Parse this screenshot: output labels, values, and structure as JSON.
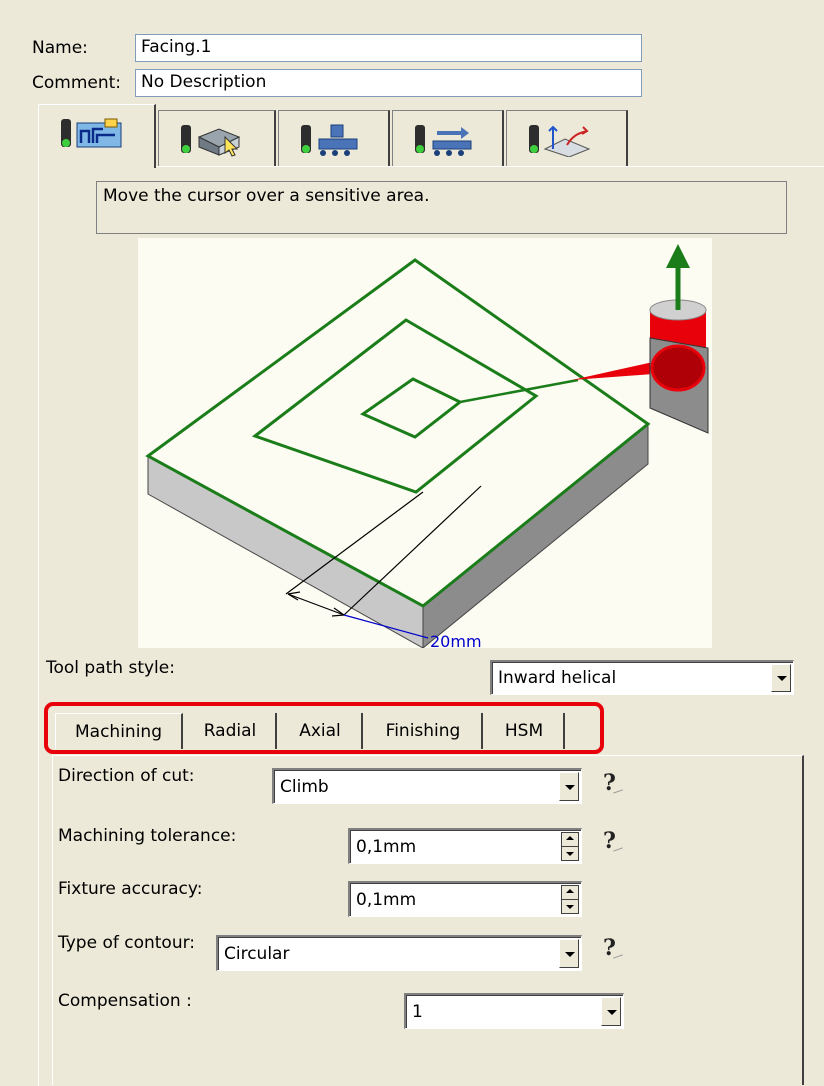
{
  "form": {
    "name_label": "Name:",
    "name_value": "Facing.1",
    "comment_label": "Comment:",
    "comment_value": "No Description"
  },
  "top_tabs": [
    {
      "icon": "strategy-parameters-icon",
      "active": true
    },
    {
      "icon": "geometry-icon",
      "active": false
    },
    {
      "icon": "tool-icon",
      "active": false
    },
    {
      "icon": "feeds-speeds-icon",
      "active": false
    },
    {
      "icon": "macro-icon",
      "active": false
    }
  ],
  "hint_text": "Move the cursor over a sensitive area.",
  "diagram": {
    "dimension_label": "20mm"
  },
  "tool_path_style": {
    "label": "Tool path style:",
    "value": "Inward helical"
  },
  "sub_tabs": [
    "Machining",
    "Radial",
    "Axial",
    "Finishing",
    "HSM"
  ],
  "machining": {
    "direction_of_cut": {
      "label": "Direction of cut:",
      "value": "Climb"
    },
    "machining_tolerance": {
      "label": "Machining tolerance:",
      "value": "0,1mm"
    },
    "fixture_accuracy": {
      "label": "Fixture accuracy:",
      "value": "0,1mm"
    },
    "type_of_contour": {
      "label": "Type of contour:",
      "value": "Circular"
    },
    "compensation": {
      "label": "Compensation :",
      "value": "1"
    },
    "help_mark": "?"
  },
  "colors": {
    "dialog_bg": "#ece9d8",
    "highlight_frame": "#e8000b",
    "toolpath_green": "#1a7d1a",
    "tool_red": "#e8000b"
  }
}
